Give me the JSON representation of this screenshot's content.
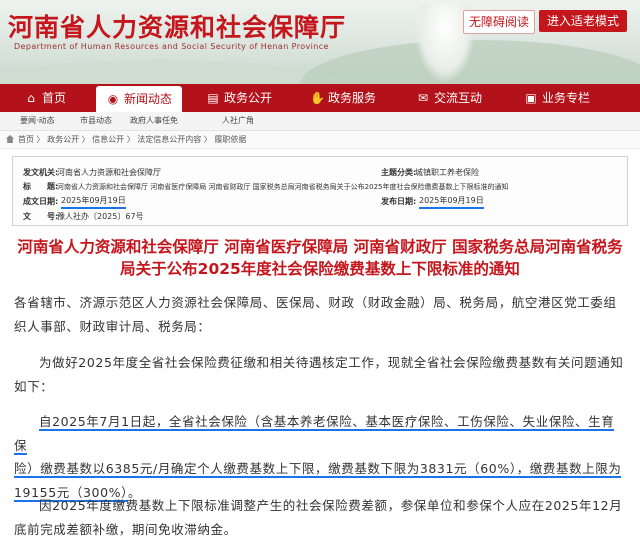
{
  "site": {
    "title": "河南省人力资源和社会保障厅",
    "subtitle": "Department of Human Resources and Social Security of Henan Province",
    "accessibility_button": "无障碍阅读",
    "elder_mode_button": "进入适老模式"
  },
  "nav": {
    "items": [
      {
        "label": "首页",
        "icon": "home-icon"
      },
      {
        "label": "新闻动态",
        "icon": "broadcast-icon",
        "active": true
      },
      {
        "label": "政务公开",
        "icon": "document-icon"
      },
      {
        "label": "政务服务",
        "icon": "handshake-icon"
      },
      {
        "label": "交流互动",
        "icon": "chat-icon"
      },
      {
        "label": "业务专栏",
        "icon": "briefcase-icon"
      }
    ]
  },
  "subnav": [
    "要闻·动态",
    "市县动态",
    "政府人事任免",
    "人社广角"
  ],
  "breadcrumb": {
    "path": "首页 〉 政务公开 〉 信息公开 〉 法定信息公开内容 〉 履职依据"
  },
  "info": {
    "issuer_label": "发文机关:",
    "issuer": "河南省人力资源和社会保障厅",
    "topic_label": "主题分类:",
    "topic": "城镇职工养老保险",
    "title_label": "标　　题:",
    "title": "河南省人力资源和社会保障厅 河南省医疗保障局 河南省财政厅 国家税务总局河南省税务局关于公布2025年度社会保险缴费基数上下限标准的通知",
    "created_label": "成文日期:",
    "created": "2025年09月19日",
    "published_label": "发布日期:",
    "published": "2025年09月19日",
    "doc_no_label": "文　　号:",
    "doc_no": "豫人社办〔2025〕67号"
  },
  "article": {
    "title": "河南省人力资源和社会保障厅 河南省医疗保障局 河南省财政厅 国家税务总局河南省税务局关于公布2025年度社会保险缴费基数上下限标准的通知",
    "recipients": "各省辖市、济源示范区人力资源社会保障局、医保局、财政（财政金融）局、税务局，航空港区党工委组织人事部、财政审计局、税务局：",
    "intro": "为做好2025年度全省社会保险费征缴和相关待遇核定工作，现就全省社会保险缴费基数有关问题通知如下：",
    "p1_line1": "自2025年7月1日起，全省社会保险（含基本养老保险、基本医疗保险、工伤保险、失业保险、生育保",
    "p1_line2": "险）缴费基数以6385元/月确定个人缴费基数上下限，缴费基数下限为3831元（60%），缴费基数上限为",
    "p1_line3": "19155元（300%）",
    "p1_end": "。",
    "p2": "因2025年度缴费基数上下限标准调整产生的社会保险费差额，参保单位和参保个人应在2025年12月底前完成差额补缴，期间免收滞纳金。"
  }
}
